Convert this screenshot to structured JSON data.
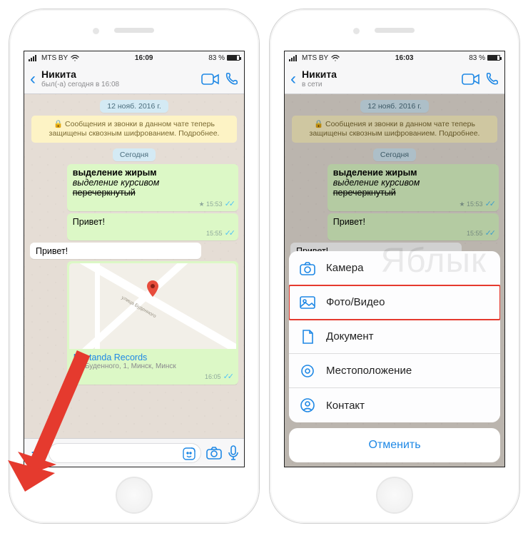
{
  "watermark": "Яблык",
  "left": {
    "status": {
      "carrier": "MTS BY",
      "time": "16:09",
      "battery": "83 %"
    },
    "nav": {
      "title": "Никита",
      "subtitle": "был(-а) сегодня в 16:08"
    },
    "pills": {
      "date1": "12 нояб. 2016 г.",
      "today": "Сегодня"
    },
    "encryption": "🔒 Сообщения и звонки в данном чате теперь защищены сквозным шифрованием. Подробнее.",
    "msg_format": {
      "bold": "выделение жирым",
      "italic": "выделение курсивом",
      "strike": "перечеркнутый",
      "time": "15:53",
      "star": "★"
    },
    "msg_out2": {
      "text": "Привет!",
      "time": "15:55"
    },
    "msg_in1": {
      "text": "Привет!"
    },
    "loc": {
      "name": "Nestanda Records",
      "addr": "ул. Буденного, 1, Минск, Минск",
      "street": "улица Буденного",
      "time": "16:05"
    }
  },
  "right": {
    "status": {
      "carrier": "MTS BY",
      "time": "16:03",
      "battery": "83 %"
    },
    "nav": {
      "title": "Никита",
      "subtitle": "в сети"
    },
    "pills": {
      "date1": "12 нояб. 2016 г.",
      "today": "Сегодня"
    },
    "encryption": "🔒 Сообщения и звонки в данном чате теперь защищены сквозным шифрованием. Подробнее.",
    "msg_format": {
      "bold": "выделение жирым",
      "italic": "выделение курсивом",
      "strike": "перечеркнутый",
      "time": "15:53",
      "star": "★"
    },
    "msg_out2": {
      "text": "Привет!",
      "time": "15:55"
    },
    "msg_in1": {
      "text": "Привет!"
    },
    "sheet": {
      "camera": "Камера",
      "photo": "Фото/Видео",
      "doc": "Документ",
      "location": "Местоположение",
      "contact": "Контакт",
      "cancel": "Отменить"
    }
  }
}
